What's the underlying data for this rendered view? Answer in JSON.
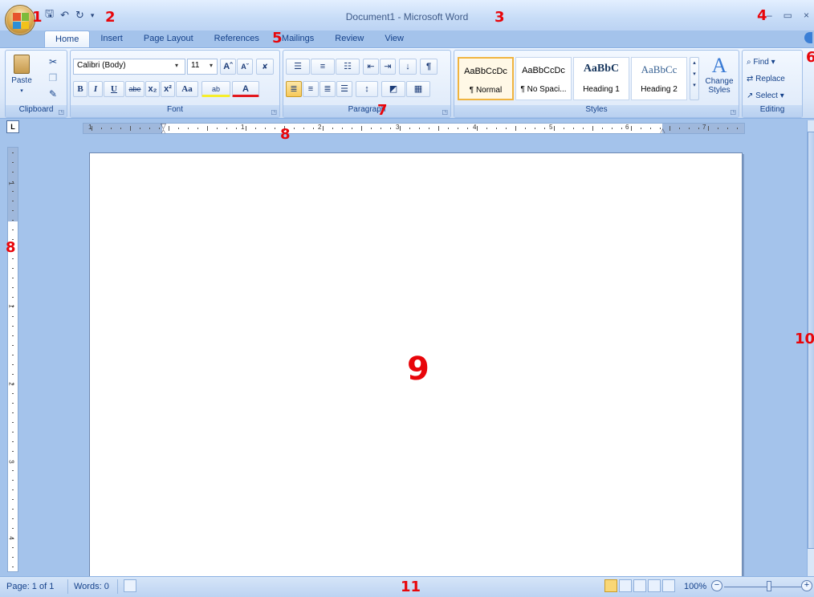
{
  "window": {
    "title": "Document1 - Microsoft Word",
    "minimize": "–",
    "restore": "▭",
    "close": "×"
  },
  "qat": {
    "save_icon": "save-icon",
    "undo_icon": "undo-icon",
    "redo_icon": "redo-icon",
    "customize_icon": "customize-qat-icon"
  },
  "tabs": [
    {
      "label": "Home",
      "active": true
    },
    {
      "label": "Insert"
    },
    {
      "label": "Page Layout"
    },
    {
      "label": "References"
    },
    {
      "label": "Mailings"
    },
    {
      "label": "Review"
    },
    {
      "label": "View"
    }
  ],
  "ribbon": {
    "clipboard": {
      "label": "Clipboard",
      "paste": "Paste"
    },
    "font": {
      "label": "Font",
      "font_name": "Calibri (Body)",
      "font_size": "11",
      "grow": "Aˆ",
      "shrink": "Aˇ",
      "bold": "B",
      "italic": "I",
      "underline": "U",
      "strike": "abe",
      "subscript": "x₂",
      "superscript": "x²",
      "change_case": "Aa",
      "highlight": "ab",
      "font_color": "A"
    },
    "paragraph": {
      "label": "Paragraph",
      "sort": "↓",
      "pilcrow": "¶"
    },
    "styles": {
      "label": "Styles",
      "items": [
        {
          "sample": "AaBbCcDc",
          "name": "¶ Normal"
        },
        {
          "sample": "AaBbCcDc",
          "name": "¶ No Spaci..."
        },
        {
          "sample": "AaBbC",
          "name": "Heading 1"
        },
        {
          "sample": "AaBbCc",
          "name": "Heading 2"
        }
      ],
      "change_styles": "Change Styles"
    },
    "editing": {
      "label": "Editing",
      "find": "Find",
      "replace": "Replace",
      "select": "Select"
    }
  },
  "ruler": {
    "tab_selector": "L",
    "h_numbers": [
      "1",
      "1",
      "2",
      "3",
      "4",
      "5",
      "6",
      "7"
    ],
    "v_numbers": [
      "1",
      "1",
      "2",
      "3",
      "4"
    ]
  },
  "status": {
    "page": "Page: 1 of 1",
    "words": "Words: 0",
    "zoom": "100%",
    "zoom_out": "−",
    "zoom_in": "+"
  },
  "markers": [
    "1",
    "2",
    "3",
    "4",
    "5",
    "6",
    "7",
    "8",
    "8",
    "9",
    "10",
    "11"
  ],
  "colors": {
    "accent": "#15428b",
    "marker": "#e8050a",
    "frame": "#a4c3eb"
  }
}
